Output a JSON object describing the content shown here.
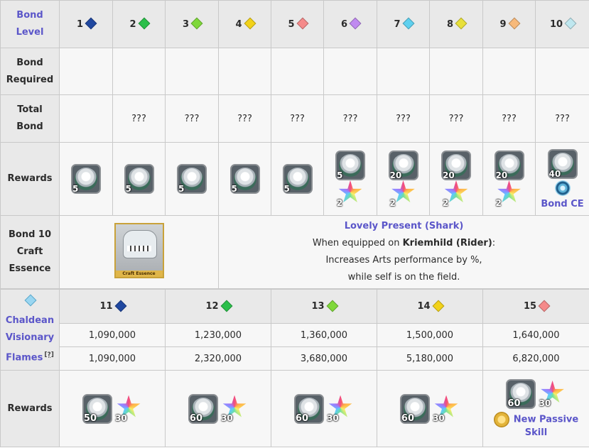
{
  "header": {
    "label_line1": "Bond",
    "label_line2": "Level"
  },
  "levels": [
    {
      "n": "1",
      "color": "#2048a0"
    },
    {
      "n": "2",
      "color": "#2bbf4a"
    },
    {
      "n": "3",
      "color": "#7fd83a"
    },
    {
      "n": "4",
      "color": "#f2d21a"
    },
    {
      "n": "5",
      "color": "#f58a8a"
    },
    {
      "n": "6",
      "color": "#c08af0"
    },
    {
      "n": "7",
      "color": "#5fd0ef"
    },
    {
      "n": "8",
      "color": "#e8e03a"
    },
    {
      "n": "9",
      "color": "#f7b97a"
    },
    {
      "n": "10",
      "color": "#bfe7ef"
    }
  ],
  "rows": {
    "bond_required": {
      "line1": "Bond",
      "line2": "Required"
    },
    "total_bond": {
      "line1": "Total",
      "line2": "Bond",
      "values": [
        "",
        "???",
        "???",
        "???",
        "???",
        "???",
        "???",
        "???",
        "???",
        "???"
      ]
    },
    "rewards": {
      "label": "Rewards"
    }
  },
  "rewards_top": [
    {
      "face": "5"
    },
    {
      "face": "5"
    },
    {
      "face": "5"
    },
    {
      "face": "5"
    },
    {
      "face": "5"
    },
    {
      "face": "5",
      "star": "2"
    },
    {
      "face": "20",
      "star": "2"
    },
    {
      "face": "20",
      "star": "2"
    },
    {
      "face": "20",
      "star": "2"
    },
    {
      "face": "40",
      "link": "Bond CE"
    }
  ],
  "ce": {
    "label_line1": "Bond 10",
    "label_line2": "Craft",
    "label_line3": "Essence",
    "image_caption": "Craft Essence",
    "name": "Lovely Present (Shark)",
    "equip_prefix": "When equipped on ",
    "equip_servant": "Kriemhild (Rider)",
    "equip_suffix": ":",
    "effect_line1": "Increases Arts performance by %,",
    "effect_line2": "while self is on the field."
  },
  "flames": {
    "line1": "Chaldean",
    "line2": "Visionary",
    "line3": "Flames",
    "sup": "[?]"
  },
  "levels2": [
    {
      "n": "11",
      "color": "#2048a0"
    },
    {
      "n": "12",
      "color": "#2bbf4a"
    },
    {
      "n": "13",
      "color": "#7fd83a"
    },
    {
      "n": "14",
      "color": "#f2d21a"
    },
    {
      "n": "15",
      "color": "#f58a8a"
    }
  ],
  "bond_required2": [
    "1,090,000",
    "1,230,000",
    "1,360,000",
    "1,500,000",
    "1,640,000"
  ],
  "total_bond2": [
    "1,090,000",
    "2,320,000",
    "3,680,000",
    "5,180,000",
    "6,820,000"
  ],
  "rewards_bottom": [
    {
      "face": "50",
      "star": "30"
    },
    {
      "face": "60",
      "star": "30"
    },
    {
      "face": "60",
      "star": "30"
    },
    {
      "face": "60",
      "star": "30"
    },
    {
      "face": "60",
      "star": "30",
      "passive_line1": "New Passive",
      "passive_line2": "Skill"
    }
  ]
}
